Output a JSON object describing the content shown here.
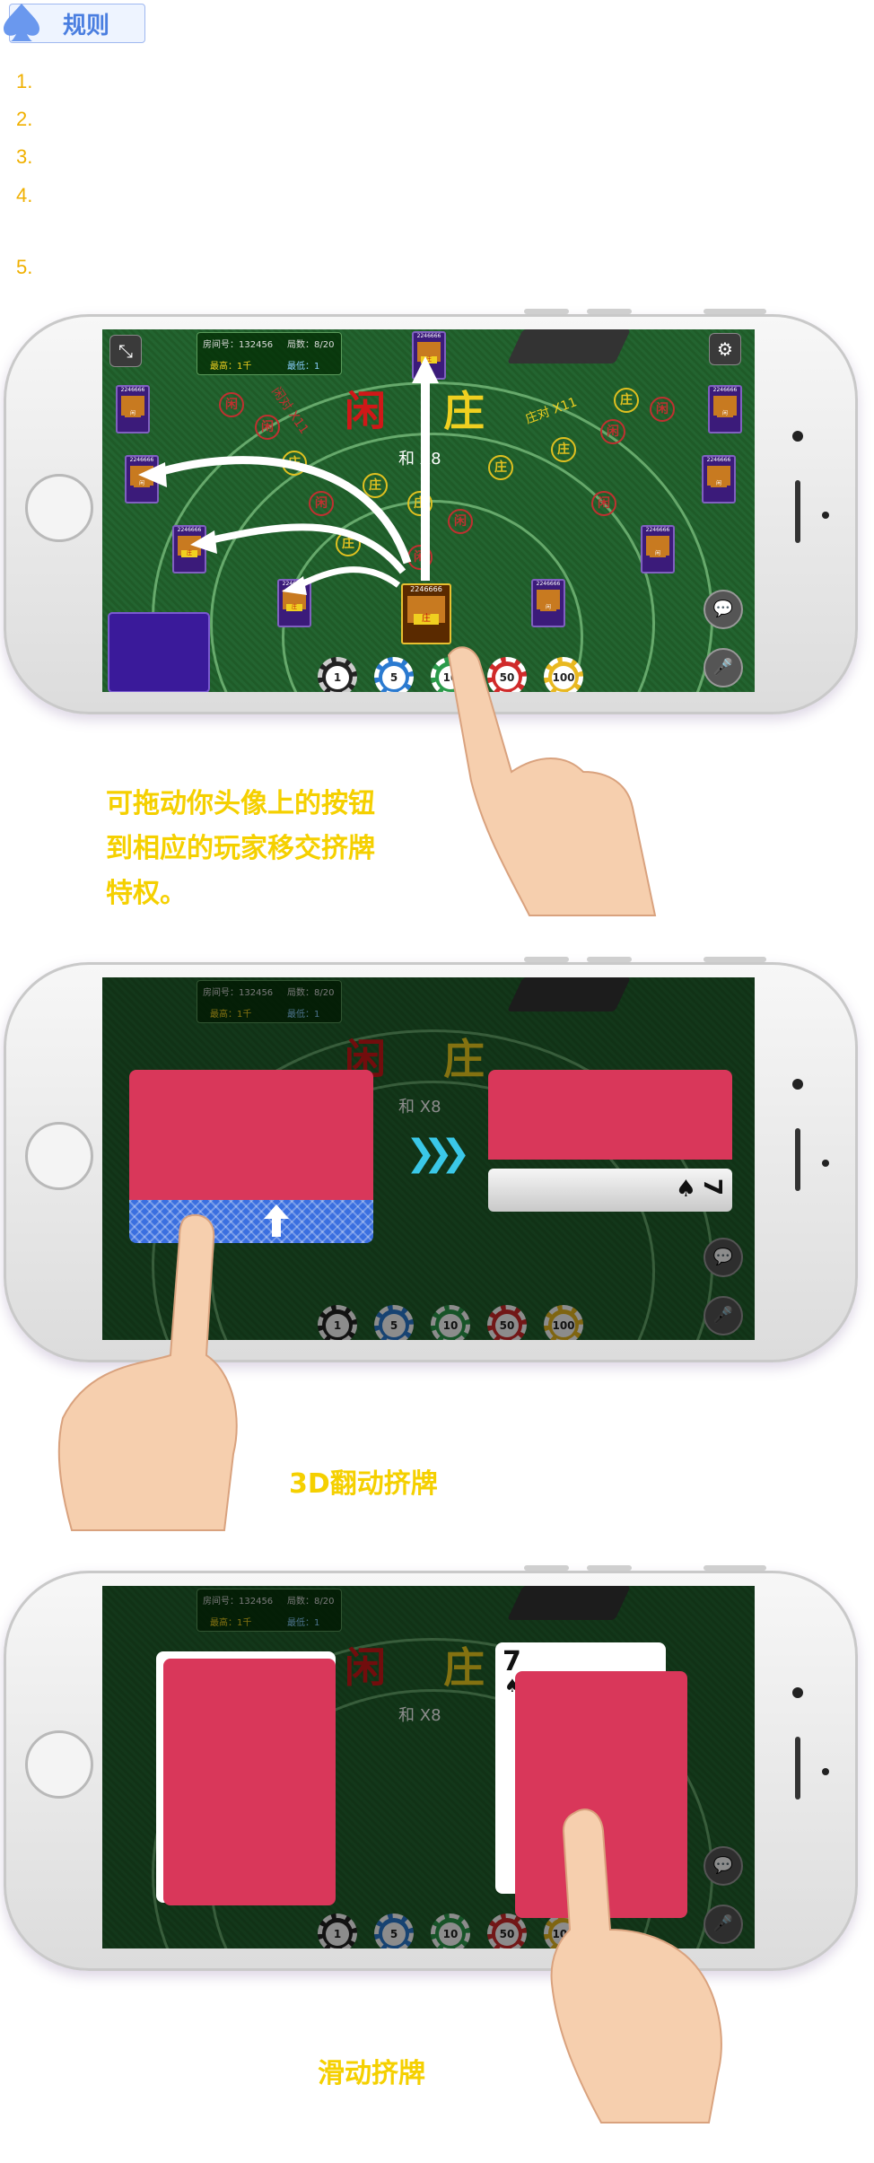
{
  "header": {
    "title": "规则"
  },
  "rules": [
    "1.",
    "2.",
    "3.",
    "4.",
    "5."
  ],
  "captions": {
    "drag_line1": "可拖动你头像上的按钮",
    "drag_line2": "到相应的玩家移交挤牌",
    "drag_line3": "特权。",
    "flip": "3D翻动挤牌",
    "slide": "滑动挤牌"
  },
  "game": {
    "room_label": "房间号：132456",
    "rounds_label": "局数：8/20",
    "max_label": "最高：1千",
    "min_label": "最低：1",
    "xian": "闲",
    "zhuang": "庄",
    "he": "和",
    "he_odds": "X8",
    "zhuang_pair": "庄对 X11",
    "xian_pair": "闲对 X11",
    "seat_id": "2246666",
    "seat_score": "224",
    "chips": [
      "1",
      "5",
      "10",
      "50",
      "100"
    ],
    "card_rank": "7",
    "card_suit": "♠"
  },
  "colors": {
    "caption": "#f5d000",
    "rule_number": "#f0b000",
    "felt": "#236430",
    "card_back": "#d9375a"
  }
}
